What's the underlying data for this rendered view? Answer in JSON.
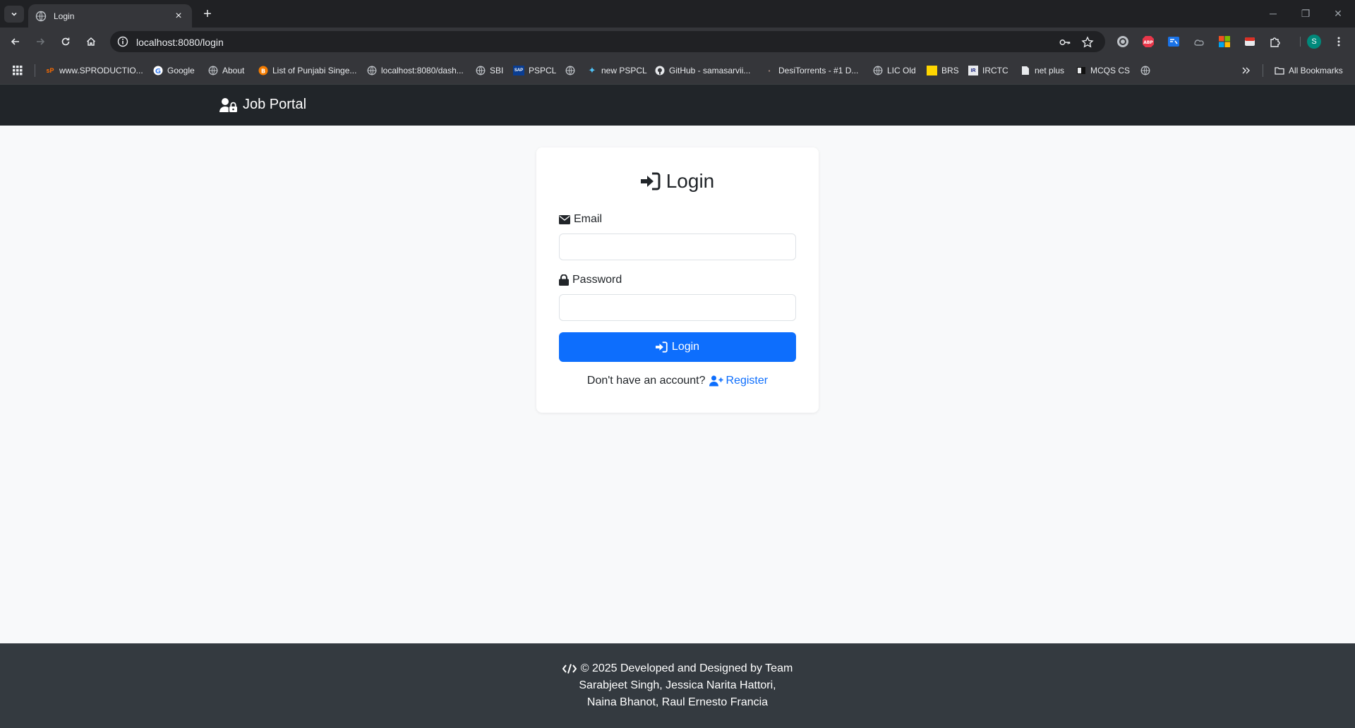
{
  "browser": {
    "tab_title": "Login",
    "url": "localhost:8080/login",
    "profile_initial": "S",
    "bookmarks": [
      {
        "label": "www.SPRODUCTIO...",
        "icon": "sp-icon"
      },
      {
        "label": "Google",
        "icon": "google-icon"
      },
      {
        "label": "About",
        "icon": "globe-icon"
      },
      {
        "label": "List of Punjabi Singe...",
        "icon": "blogger-icon"
      },
      {
        "label": "localhost:8080/dash...",
        "icon": "globe-icon"
      },
      {
        "label": "SBI",
        "icon": "globe-icon"
      },
      {
        "label": "PSPCL",
        "icon": "sap-icon"
      },
      {
        "label": "",
        "icon": "globe-icon"
      },
      {
        "label": "new PSPCL",
        "icon": "sparkle-icon"
      },
      {
        "label": "GitHub - samasarvii...",
        "icon": "github-icon"
      },
      {
        "label": "DesiTorrents - #1 D...",
        "icon": "torrent-icon"
      },
      {
        "label": "LIC Old",
        "icon": "globe-icon"
      },
      {
        "label": "BRS",
        "icon": "brs-icon"
      },
      {
        "label": "IRCTC",
        "icon": "irctc-icon"
      },
      {
        "label": "net plus",
        "icon": "document-icon"
      },
      {
        "label": "MCQS CS",
        "icon": "mcqs-icon"
      },
      {
        "label": "",
        "icon": "globe-icon"
      }
    ],
    "all_bookmarks_label": "All Bookmarks"
  },
  "navbar": {
    "brand": "Job Portal"
  },
  "login_card": {
    "title": "Login",
    "email_label": "Email",
    "email_value": "",
    "password_label": "Password",
    "password_value": "",
    "submit_label": "Login",
    "register_prompt": "Don't have an account?",
    "register_link": "Register"
  },
  "footer": {
    "line1": "© 2025 Developed and Designed by Team",
    "line2": "Sarabjeet Singh, Jessica Narita Hattori,",
    "line3": "Naina Bhanot, Raul Ernesto Francia"
  },
  "colors": {
    "primary": "#0d6efd",
    "navbar_bg": "#212529",
    "footer_bg": "#343a40",
    "page_bg": "#f8f9fa"
  }
}
